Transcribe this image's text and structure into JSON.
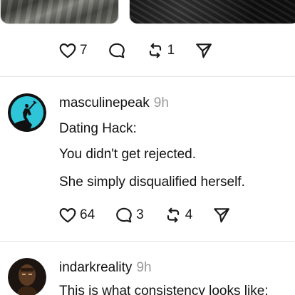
{
  "feed": {
    "previous_post": {
      "likes": "7",
      "comments": "",
      "reposts": "1"
    },
    "posts": [
      {
        "username": "masculinepeak",
        "time": "9h",
        "lines": [
          "Dating Hack:",
          "You didn't get rejected.",
          "She simply disqualified herself."
        ],
        "likes": "64",
        "comments": "3",
        "reposts": "4",
        "avatar_color": "#2ec5d8"
      },
      {
        "username": "indarkreality",
        "time": "9h",
        "lines": [
          "This is what consistency looks like:"
        ]
      }
    ]
  },
  "icons": {
    "like": "heart-icon",
    "comment": "comment-bubble-icon",
    "repost": "repost-icon",
    "share": "send-icon"
  }
}
